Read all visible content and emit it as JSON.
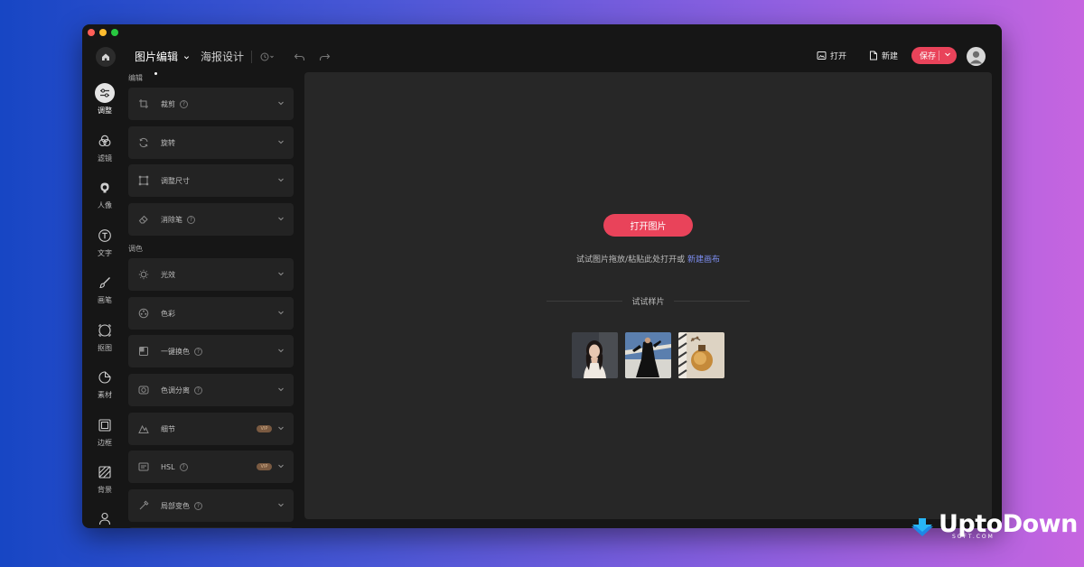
{
  "window": {
    "tabs": [
      {
        "label": "图片编辑",
        "active": true
      },
      {
        "label": "海报设计",
        "active": false
      }
    ],
    "actions": {
      "open_label": "打开",
      "new_label": "新建",
      "save_label": "保存"
    }
  },
  "rail": {
    "items": [
      {
        "label": "调整",
        "icon": "adjust-icon",
        "active": true
      },
      {
        "label": "滤镜",
        "icon": "filter-icon"
      },
      {
        "label": "人像",
        "icon": "portrait-icon"
      },
      {
        "label": "文字",
        "icon": "text-icon"
      },
      {
        "label": "画笔",
        "icon": "brush-icon"
      },
      {
        "label": "抠图",
        "icon": "cutout-icon"
      },
      {
        "label": "素材",
        "icon": "sticker-icon"
      },
      {
        "label": "边框",
        "icon": "frame-icon"
      },
      {
        "label": "背景",
        "icon": "background-icon"
      },
      {
        "label": "",
        "icon": "user-icon"
      }
    ]
  },
  "panel": {
    "section_edit": "编辑",
    "section_color": "调色",
    "edit_items": [
      {
        "label": "裁剪",
        "help": true,
        "icon": "crop-icon"
      },
      {
        "label": "旋转",
        "icon": "rotate-icon"
      },
      {
        "label": "调整尺寸",
        "icon": "resize-icon"
      },
      {
        "label": "消除笔",
        "help": true,
        "icon": "eraser-icon"
      }
    ],
    "color_items": [
      {
        "label": "光效",
        "icon": "light-icon"
      },
      {
        "label": "色彩",
        "icon": "color-icon"
      },
      {
        "label": "一键换色",
        "help": true,
        "icon": "recolor-icon"
      },
      {
        "label": "色调分离",
        "help": true,
        "icon": "split-tone-icon"
      },
      {
        "label": "细节",
        "vip": true,
        "icon": "detail-icon"
      },
      {
        "label": "HSL",
        "help": true,
        "vip": true,
        "icon": "hsl-icon"
      },
      {
        "label": "局部变色",
        "help": true,
        "icon": "local-color-icon"
      }
    ],
    "vip_badge": "VIP",
    "help_glyph": "?"
  },
  "canvas": {
    "open_button": "打开图片",
    "hint_text": "试试图片拖放/粘贴此处打开或",
    "hint_link": "新建画布",
    "samples_title": "试试样片"
  },
  "watermark": {
    "brand": "UptoDown",
    "sub": "SOFT.COM"
  },
  "colors": {
    "accent": "#e9435a",
    "link": "#7d8ef0",
    "window_bg": "#161616",
    "canvas_bg": "#272727"
  }
}
